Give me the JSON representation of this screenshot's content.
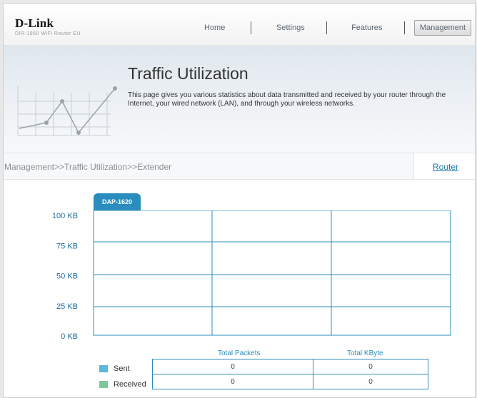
{
  "brand": {
    "name": "D-Link",
    "tagline": "DIR-1960 WiFi Router EU"
  },
  "nav": {
    "items": [
      "Home",
      "Settings",
      "Features",
      "Management"
    ],
    "active": "Management"
  },
  "header": {
    "title": "Traffic Utilization",
    "description": "This page gives you various statistics about data transmitted and received by your router through the Internet, your wired network (LAN), and through your wireless networks."
  },
  "breadcrumb": {
    "path": "Management>>Traffic Utilization>>Extender",
    "router_link": "Router"
  },
  "tab": {
    "label": "DAP-1620"
  },
  "chart_data": {
    "type": "line",
    "title": "",
    "xlabel": "",
    "ylabel": "",
    "y_ticks": [
      "100 KB",
      "75 KB",
      "50 KB",
      "25 KB",
      "0 KB"
    ],
    "ylim": [
      0,
      100
    ],
    "grid": true,
    "series": []
  },
  "stats": {
    "columns": [
      "Total Packets",
      "Total KByte"
    ],
    "rows": [
      {
        "label": "Sent",
        "color": "#5bb6e0",
        "packets": "0",
        "kbyte": "0"
      },
      {
        "label": "Received",
        "color": "#7ec79a",
        "packets": "0",
        "kbyte": "0"
      }
    ]
  },
  "colors": {
    "accent": "#2a8dbd",
    "link": "#1f78a8"
  }
}
